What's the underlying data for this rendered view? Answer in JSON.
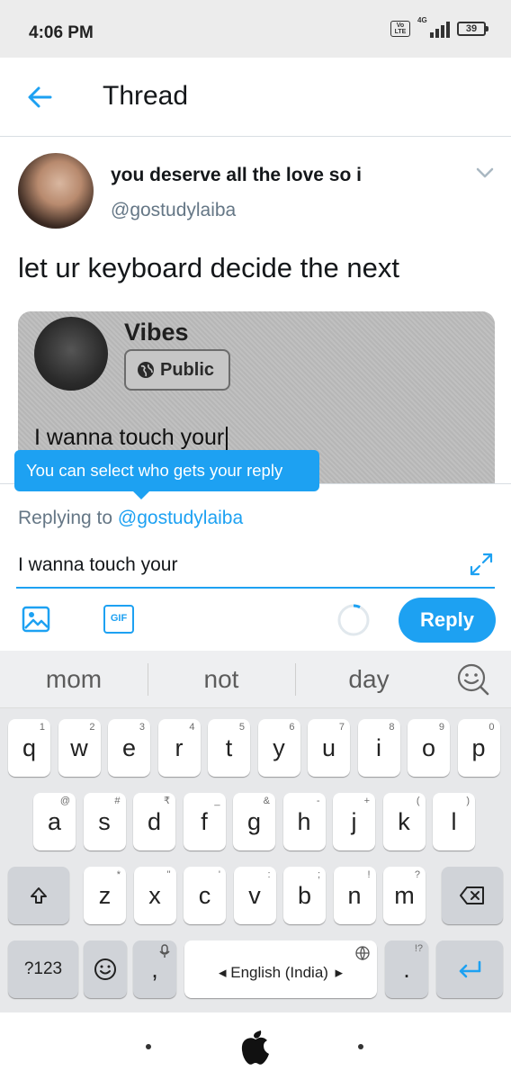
{
  "status_bar": {
    "time": "4:06 PM",
    "volte": "Vo LTE",
    "network": "4G",
    "battery": "39"
  },
  "header": {
    "title": "Thread",
    "back_icon": "back-arrow-icon"
  },
  "tweet": {
    "author": "you deserve all the love so i",
    "handle": "@gostudylaiba",
    "text": "let ur keyboard decide the next",
    "media": {
      "title": "Vibes",
      "badge": "Public",
      "line": "I wanna touch your"
    }
  },
  "tooltip": {
    "text": "You can select who gets your reply"
  },
  "composer": {
    "replying_prefix": "Replying to",
    "replying_handle": "@gostudylaiba",
    "input_value": "I wanna touch your",
    "gif_label": "GIF",
    "reply_label": "Reply"
  },
  "keyboard": {
    "suggestions": [
      "mom",
      "not",
      "day"
    ],
    "row1": [
      {
        "k": "q",
        "h": "1"
      },
      {
        "k": "w",
        "h": "2"
      },
      {
        "k": "e",
        "h": "3"
      },
      {
        "k": "r",
        "h": "4"
      },
      {
        "k": "t",
        "h": "5"
      },
      {
        "k": "y",
        "h": "6"
      },
      {
        "k": "u",
        "h": "7"
      },
      {
        "k": "i",
        "h": "8"
      },
      {
        "k": "o",
        "h": "9"
      },
      {
        "k": "p",
        "h": "0"
      }
    ],
    "row2": [
      {
        "k": "a",
        "h": "@"
      },
      {
        "k": "s",
        "h": "#"
      },
      {
        "k": "d",
        "h": "₹"
      },
      {
        "k": "f",
        "h": "_"
      },
      {
        "k": "g",
        "h": "&"
      },
      {
        "k": "h",
        "h": "-"
      },
      {
        "k": "j",
        "h": "+"
      },
      {
        "k": "k",
        "h": "("
      },
      {
        "k": "l",
        "h": ")"
      }
    ],
    "row3": [
      {
        "k": "z",
        "h": "*"
      },
      {
        "k": "x",
        "h": "\""
      },
      {
        "k": "c",
        "h": "'"
      },
      {
        "k": "v",
        "h": ":"
      },
      {
        "k": "b",
        "h": ";"
      },
      {
        "k": "n",
        "h": "!"
      },
      {
        "k": "m",
        "h": "?"
      }
    ],
    "symbols_label": "?123",
    "comma": ",",
    "period": ".",
    "period_hint": "!?",
    "space_label": "English (India)"
  },
  "colors": {
    "accent": "#1da1f2",
    "status_bg": "#ececec",
    "keyboard_bg": "#e7e8ea"
  }
}
